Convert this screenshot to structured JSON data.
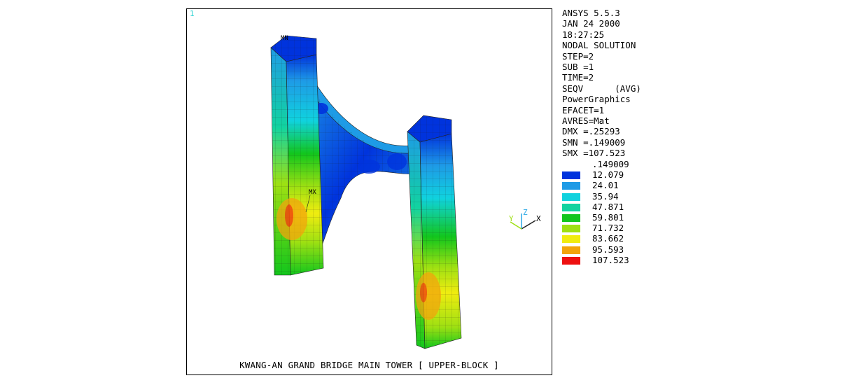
{
  "viewport": {
    "window_number": "1",
    "title": "KWANG-AN GRAND BRIDGE MAIN TOWER [ UPPER-BLOCK ]",
    "min_marker": "MN",
    "max_marker": "MX"
  },
  "triad": {
    "x_label": "X",
    "y_label": "Y",
    "z_label": "Z"
  },
  "info": {
    "lines": [
      "ANSYS 5.5.3",
      "JAN 24 2000",
      "18:27:25",
      "NODAL SOLUTION",
      "STEP=2",
      "SUB =1",
      "TIME=2",
      "SEQV      (AVG)",
      "PowerGraphics",
      "EFACET=1",
      "AVRES=Mat",
      "DMX =.25293",
      "SMN =.149009",
      "SMX =107.523"
    ]
  },
  "legend": {
    "min_label": ".149009",
    "levels": [
      {
        "label": "12.079",
        "color": "#0033dd"
      },
      {
        "label": "24.01",
        "color": "#1e9be6"
      },
      {
        "label": "35.94",
        "color": "#10d2de"
      },
      {
        "label": "47.871",
        "color": "#12d3a0"
      },
      {
        "label": "59.801",
        "color": "#12c61c"
      },
      {
        "label": "71.732",
        "color": "#9ee012"
      },
      {
        "label": "83.662",
        "color": "#f0ec10"
      },
      {
        "label": "95.593",
        "color": "#f2a40c"
      },
      {
        "label": "107.523",
        "color": "#ee1010"
      }
    ]
  }
}
